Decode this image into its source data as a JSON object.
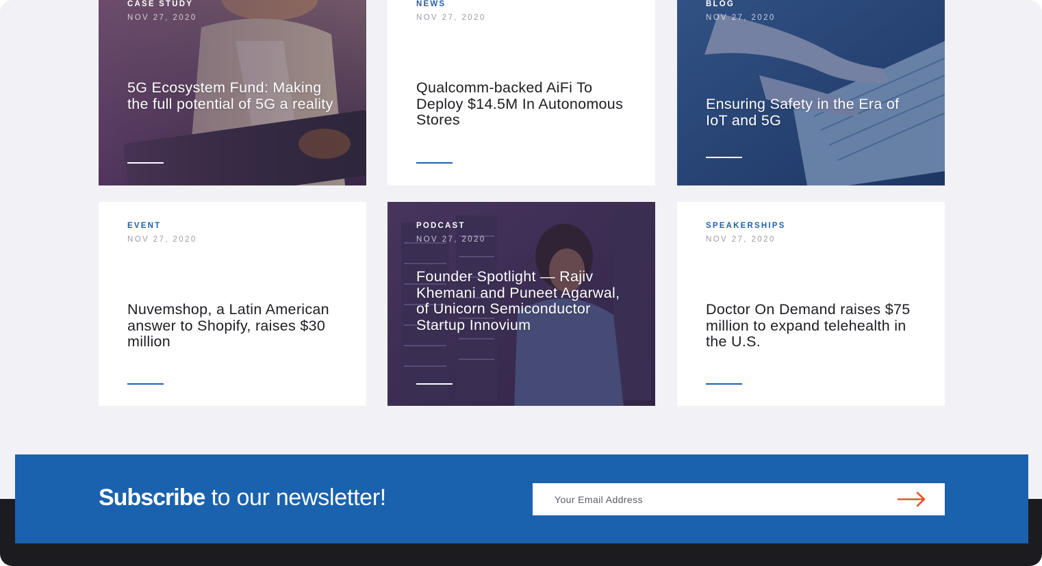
{
  "cards": [
    {
      "category": "CASE STUDY",
      "date": "NOV 27, 2020",
      "title": "5G Ecosystem Fund: Making the full potential of 5G a reality"
    },
    {
      "category": "NEWS",
      "date": "NOV 27, 2020",
      "title": "Qualcomm-backed AiFi To Deploy $14.5M In Autonomous Stores"
    },
    {
      "category": "BLOG",
      "date": "NOV 27, 2020",
      "title": "Ensuring Safety in the Era of IoT and 5G"
    },
    {
      "category": "EVENT",
      "date": "NOV 27, 2020",
      "title": "Nuvemshop, a Latin American answer to Shopify, raises $30 million"
    },
    {
      "category": "PODCAST",
      "date": "NOV 27, 2020",
      "title": "Founder Spotlight — Rajiv Khemani and Puneet Agarwal, of Unicorn Semiconductor Startup Innovium"
    },
    {
      "category": "SPEAKERSHIPS",
      "date": "NOV 27, 2020",
      "title": "Doctor On Demand raises $75 million to expand telehealth in the U.S."
    }
  ],
  "newsletter": {
    "heading_strong": "Subscribe",
    "heading_rest": " to our newsletter!",
    "email_placeholder": "Your Email Address",
    "submit_icon": "arrow-right-icon"
  },
  "colors": {
    "accent_blue": "#1d5fae",
    "newsletter_band": "#1a62ae",
    "arrow_orange": "#e8552d",
    "page_bg": "#f2f2f6",
    "footer_dark": "#1c1c20"
  }
}
